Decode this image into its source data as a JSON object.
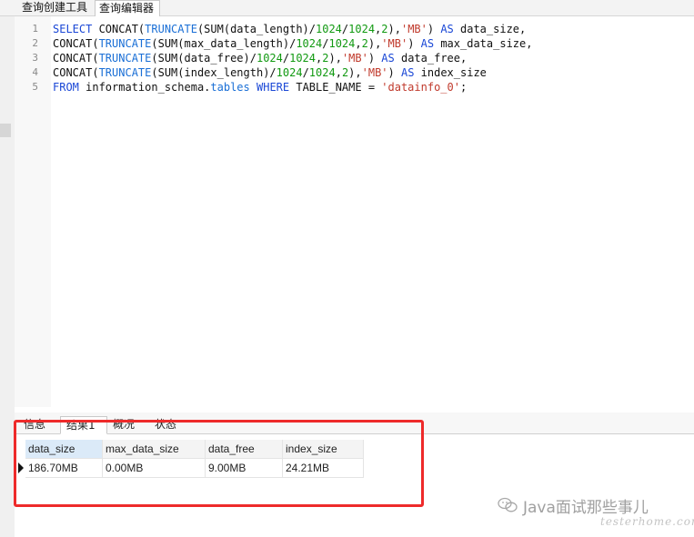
{
  "top_tabs": [
    {
      "label": "查询创建工具"
    },
    {
      "label": "查询编辑器"
    }
  ],
  "editor": {
    "lines": [
      {
        "num": "1",
        "tokens": [
          {
            "t": "SELECT",
            "c": "kw"
          },
          {
            "t": " CONCAT(",
            "c": "plain"
          },
          {
            "t": "TRUNCATE",
            "c": "fn"
          },
          {
            "t": "(SUM(data_length)/",
            "c": "plain"
          },
          {
            "t": "1024",
            "c": "num"
          },
          {
            "t": "/",
            "c": "plain"
          },
          {
            "t": "1024",
            "c": "num"
          },
          {
            "t": ",",
            "c": "plain"
          },
          {
            "t": "2",
            "c": "num"
          },
          {
            "t": "),",
            "c": "plain"
          },
          {
            "t": "'MB'",
            "c": "str"
          },
          {
            "t": ") ",
            "c": "plain"
          },
          {
            "t": "AS",
            "c": "kw"
          },
          {
            "t": " data_size,",
            "c": "plain"
          }
        ]
      },
      {
        "num": "2",
        "tokens": [
          {
            "t": "CONCAT(",
            "c": "plain"
          },
          {
            "t": "TRUNCATE",
            "c": "fn"
          },
          {
            "t": "(SUM(max_data_length)/",
            "c": "plain"
          },
          {
            "t": "1024",
            "c": "num"
          },
          {
            "t": "/",
            "c": "plain"
          },
          {
            "t": "1024",
            "c": "num"
          },
          {
            "t": ",",
            "c": "plain"
          },
          {
            "t": "2",
            "c": "num"
          },
          {
            "t": "),",
            "c": "plain"
          },
          {
            "t": "'MB'",
            "c": "str"
          },
          {
            "t": ") ",
            "c": "plain"
          },
          {
            "t": "AS",
            "c": "kw"
          },
          {
            "t": " max_data_size,",
            "c": "plain"
          }
        ]
      },
      {
        "num": "3",
        "tokens": [
          {
            "t": "CONCAT(",
            "c": "plain"
          },
          {
            "t": "TRUNCATE",
            "c": "fn"
          },
          {
            "t": "(SUM(data_free)/",
            "c": "plain"
          },
          {
            "t": "1024",
            "c": "num"
          },
          {
            "t": "/",
            "c": "plain"
          },
          {
            "t": "1024",
            "c": "num"
          },
          {
            "t": ",",
            "c": "plain"
          },
          {
            "t": "2",
            "c": "num"
          },
          {
            "t": "),",
            "c": "plain"
          },
          {
            "t": "'MB'",
            "c": "str"
          },
          {
            "t": ") ",
            "c": "plain"
          },
          {
            "t": "AS",
            "c": "kw"
          },
          {
            "t": " data_free,",
            "c": "plain"
          }
        ]
      },
      {
        "num": "4",
        "tokens": [
          {
            "t": "CONCAT(",
            "c": "plain"
          },
          {
            "t": "TRUNCATE",
            "c": "fn"
          },
          {
            "t": "(SUM(index_length)/",
            "c": "plain"
          },
          {
            "t": "1024",
            "c": "num"
          },
          {
            "t": "/",
            "c": "plain"
          },
          {
            "t": "1024",
            "c": "num"
          },
          {
            "t": ",",
            "c": "plain"
          },
          {
            "t": "2",
            "c": "num"
          },
          {
            "t": "),",
            "c": "plain"
          },
          {
            "t": "'MB'",
            "c": "str"
          },
          {
            "t": ") ",
            "c": "plain"
          },
          {
            "t": "AS",
            "c": "kw"
          },
          {
            "t": " index_size",
            "c": "plain"
          }
        ]
      },
      {
        "num": "5",
        "tokens": [
          {
            "t": "FROM",
            "c": "kw"
          },
          {
            "t": " information_schema.",
            "c": "plain"
          },
          {
            "t": "tables",
            "c": "fn"
          },
          {
            "t": " ",
            "c": "plain"
          },
          {
            "t": "WHERE",
            "c": "kw"
          },
          {
            "t": " TABLE_NAME = ",
            "c": "plain"
          },
          {
            "t": "'datainfo_0'",
            "c": "str"
          },
          {
            "t": ";",
            "c": "plain"
          }
        ]
      }
    ]
  },
  "result_tabs": [
    {
      "label": "信息"
    },
    {
      "label": "结果1"
    },
    {
      "label": "概况"
    },
    {
      "label": "状态"
    }
  ],
  "grid": {
    "columns": [
      "data_size",
      "max_data_size",
      "data_free",
      "index_size"
    ],
    "rows": [
      [
        "186.70MB",
        "0.00MB",
        "9.00MB",
        "24.21MB"
      ]
    ]
  },
  "watermark": {
    "text": "Java面试那些事儿",
    "sub": "testerhome.com"
  },
  "colors": {
    "keyword": "#1a47d6",
    "number": "#119911",
    "string": "#c0392b",
    "highlight": "#ee2a2a"
  }
}
